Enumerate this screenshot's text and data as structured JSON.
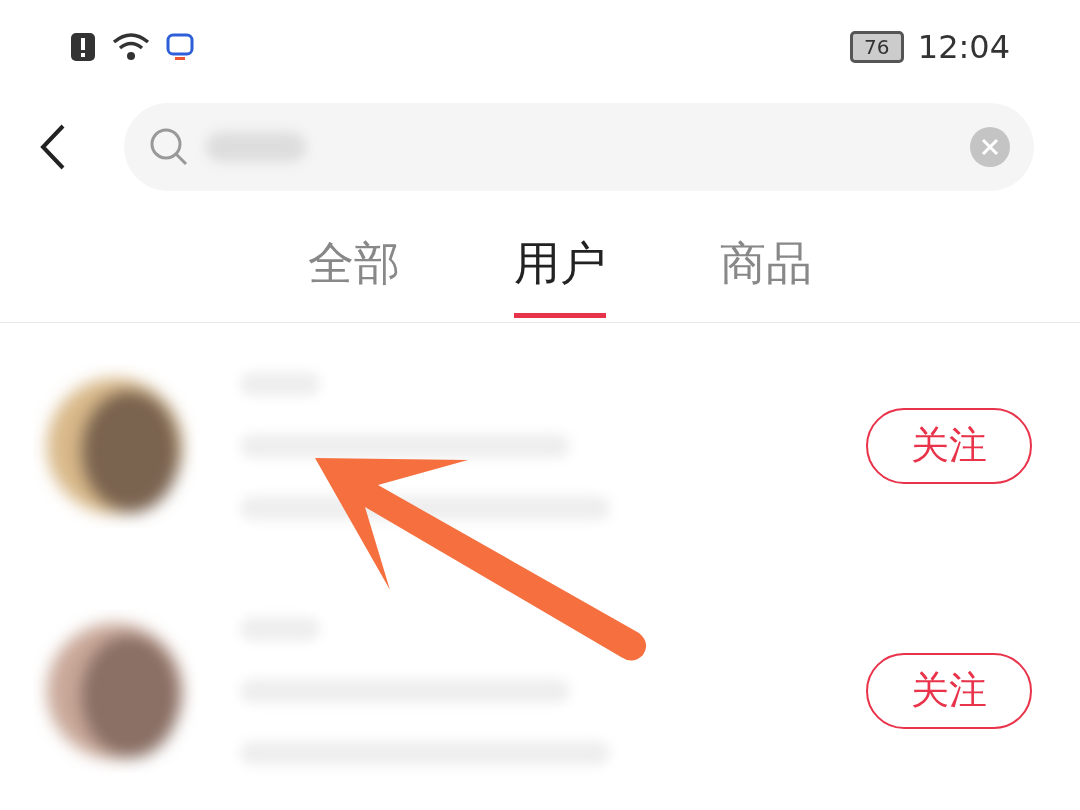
{
  "status_bar": {
    "battery": "76",
    "time": "12:04"
  },
  "search": {
    "has_value": true
  },
  "tabs": [
    {
      "label": "全部",
      "selected": false
    },
    {
      "label": "用户",
      "selected": true
    },
    {
      "label": "商品",
      "selected": false
    }
  ],
  "users": [
    {
      "follow_label": "关注"
    },
    {
      "follow_label": "关注"
    }
  ]
}
